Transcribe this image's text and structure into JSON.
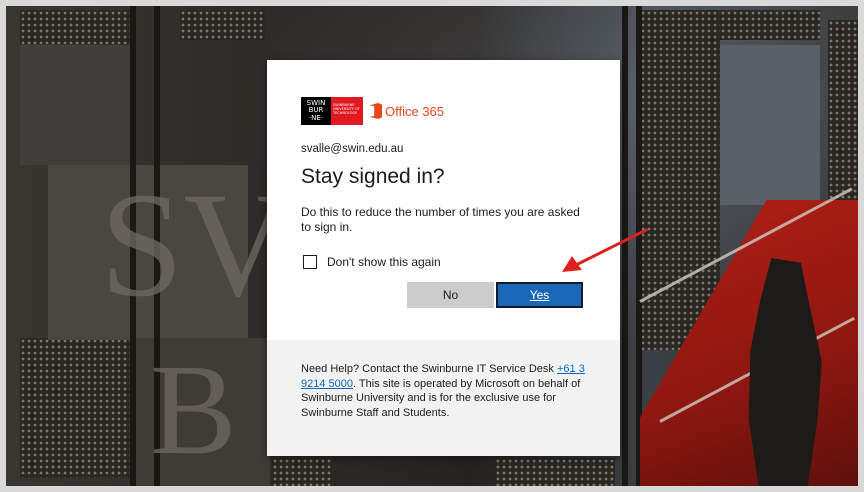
{
  "dialog": {
    "brand": {
      "institution_logo_lines": [
        "SWIN",
        "BUR",
        "·NE·"
      ],
      "institution_logo_sub": "SWINBURNE UNIVERSITY OF TECHNOLOGY",
      "product_name": "Office 365"
    },
    "username": "svalle@swin.edu.au",
    "title": "Stay signed in?",
    "description": "Do this to reduce the number of times you are asked to sign in.",
    "checkbox_label": "Don't show this again",
    "checkbox_checked": false,
    "no_label": "No",
    "yes_label": "Yes",
    "help": {
      "text_before": "Need Help? Contact the Swinburne IT Service Desk ",
      "phone": "+61 3 9214 5000",
      "text_after": ". This site is operated by Microsoft on behalf of Swinburne University and is for the exclusive use for Swinburne Staff and Students."
    }
  },
  "colors": {
    "primary_button": "#1a67b8",
    "secondary_button": "#cccccc",
    "brand_red": "#e11a22",
    "office_orange": "#e8461c",
    "annotation_arrow": "#e02020"
  },
  "annotation": {
    "type": "arrow",
    "points_to": "yes-button"
  }
}
